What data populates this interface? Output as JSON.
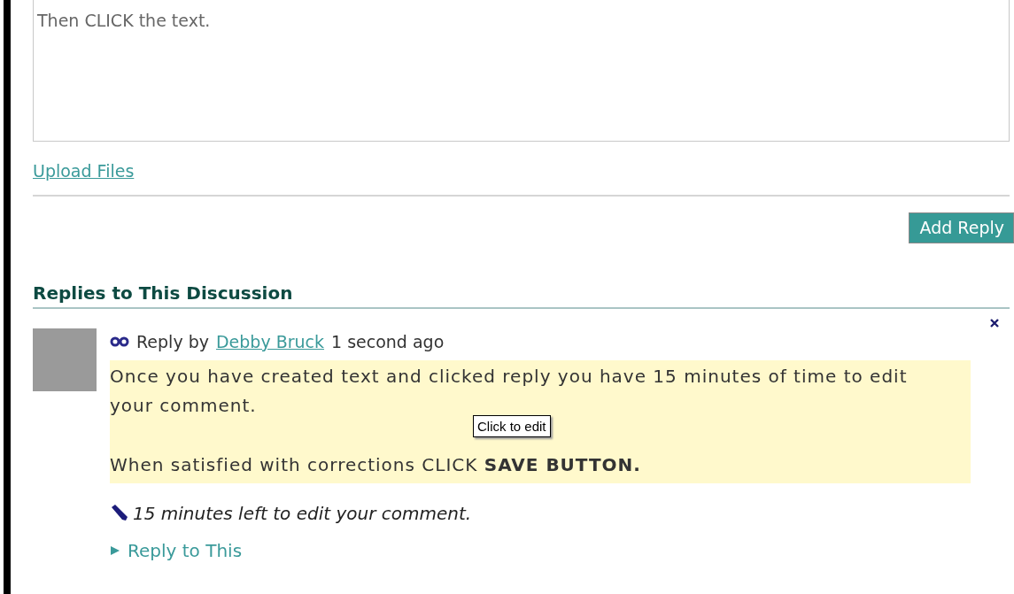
{
  "reply_editor": {
    "value": "Then CLICK the text."
  },
  "upload_link": "Upload Files",
  "add_reply_button": "Add Reply",
  "replies_heading": "Replies to This Discussion",
  "reply": {
    "prefix": "Reply by",
    "author": "Debby Bruck",
    "time": "1 second ago",
    "paragraphs": [
      "Once you have created text and clicked reply you have 15 minutes of time to edit your comment.",
      "When satisfied with corrections CLICK **SAVE BUTTON.**"
    ],
    "tooltip": "Click to edit",
    "edit_notice": "15 minutes left to edit your comment.",
    "reply_link": "Reply to This"
  }
}
